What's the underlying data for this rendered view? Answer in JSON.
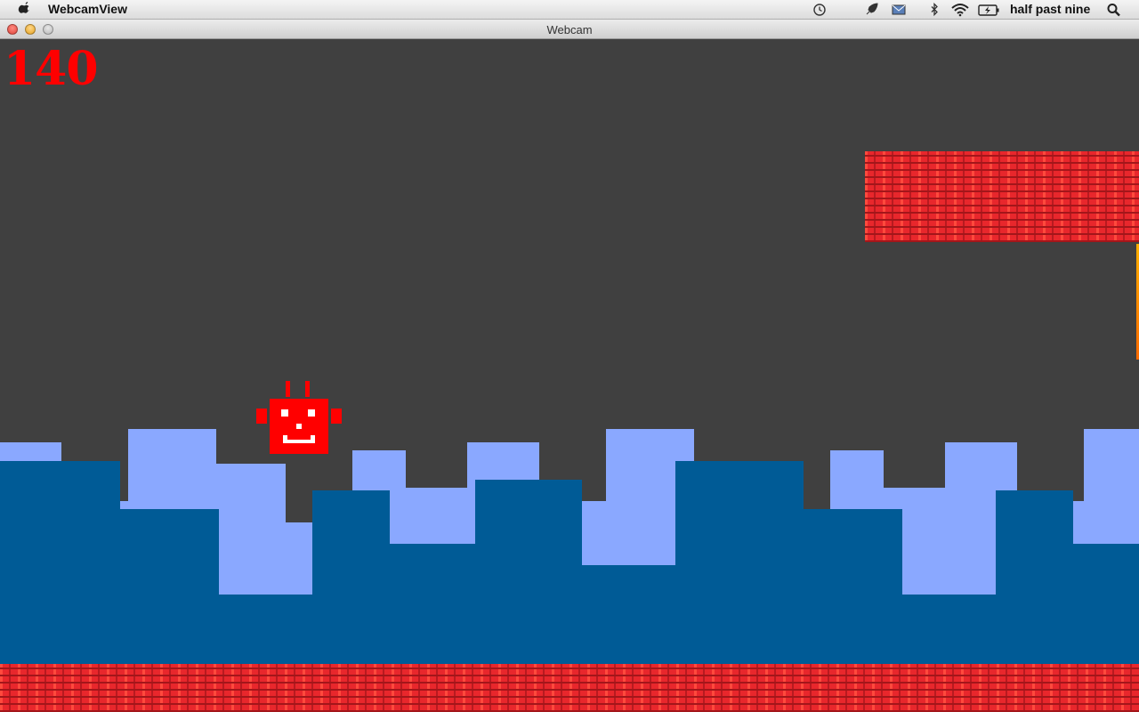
{
  "menubar": {
    "app_name": "WebcamView",
    "clock": "half past nine",
    "icons": [
      "apple-icon",
      "timemachine-icon",
      "rocket-icon",
      "mail-icon",
      "bluetooth-icon",
      "wifi-icon",
      "battery-icon",
      "search-icon"
    ]
  },
  "window": {
    "title": "Webcam"
  },
  "game": {
    "score": "140",
    "colors": {
      "background": "#404040",
      "score": "#ff0000",
      "robot": "#ff0000",
      "skyline_back": "#8aa8ff",
      "skyline_front": "#005b96",
      "brick": "#e8272c"
    }
  }
}
